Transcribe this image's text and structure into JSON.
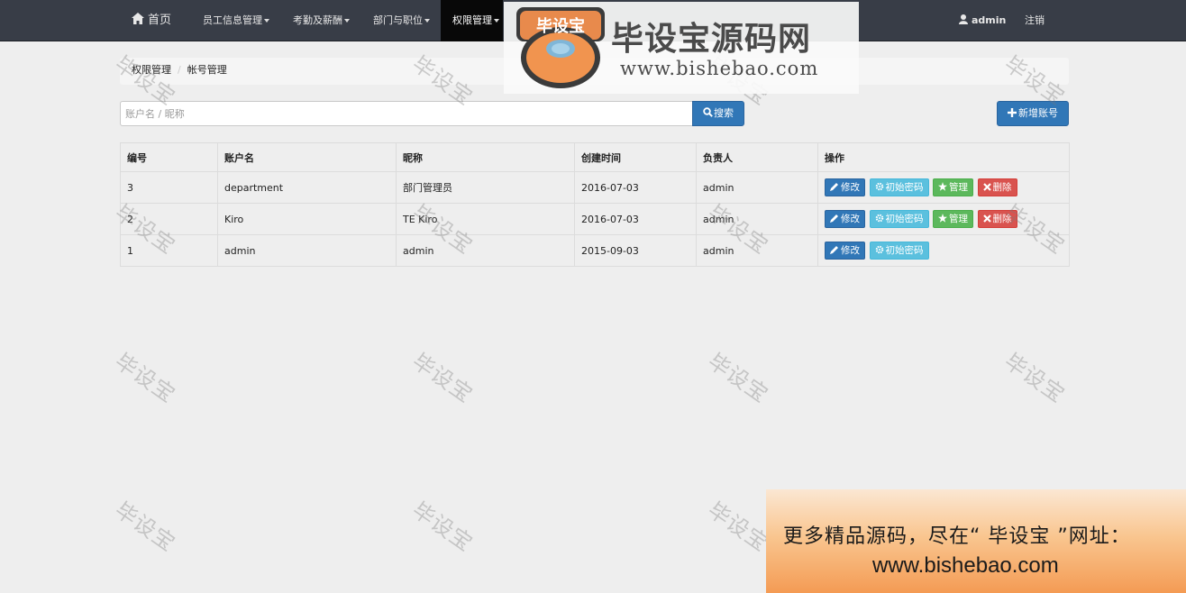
{
  "navbar": {
    "home": "首页",
    "menus": [
      "员工信息管理",
      "考勤及薪酬",
      "部门与职位",
      "权限管理"
    ],
    "user": "admin",
    "logout": "注销"
  },
  "breadcrumb": {
    "parent": "权限管理",
    "current": "帐号管理"
  },
  "search": {
    "placeholder": "账户名 / 昵称",
    "button": "搜索"
  },
  "add_button": "新增账号",
  "table": {
    "headers": [
      "编号",
      "账户名",
      "昵称",
      "创建时间",
      "负责人",
      "操作"
    ],
    "rows": [
      {
        "id": "3",
        "account": "department",
        "nickname": "部门管理员",
        "created": "2016-07-03",
        "owner": "admin"
      },
      {
        "id": "2",
        "account": "Kiro",
        "nickname": "TE Kiro",
        "created": "2016-07-03",
        "owner": "admin"
      },
      {
        "id": "1",
        "account": "admin",
        "nickname": "admin",
        "created": "2015-09-03",
        "owner": "admin"
      }
    ],
    "actions": {
      "edit": "修改",
      "reset": "初始密码",
      "manage": "管理",
      "delete": "删除"
    }
  },
  "watermark": {
    "text": "毕设宝"
  },
  "logo": {
    "badge": "毕设宝",
    "name": "毕设宝源码网",
    "url": "www.bishebao.com"
  },
  "promo": {
    "line1": "更多精品源码，尽在“ 毕设宝 ”网址：",
    "line2": "www.bishebao.com"
  },
  "colors": {
    "primary": "#3177b7",
    "info": "#5bc0de",
    "success": "#5cb85c",
    "danger": "#d9534f",
    "navbar": "#383d47"
  }
}
